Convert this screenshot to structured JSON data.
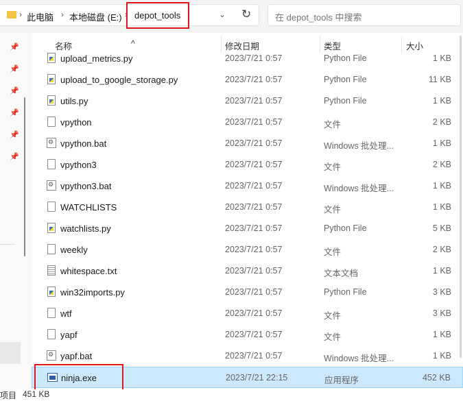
{
  "addressbar": {
    "crumbs": [
      "此电脑",
      "本地磁盘 (E:)",
      "depot_tools"
    ],
    "separator": "›",
    "dropdown_glyph": "⌄",
    "refresh_glyph": "↻"
  },
  "search": {
    "placeholder": "在 depot_tools 中搜索"
  },
  "columns": {
    "name": "名称",
    "date": "修改日期",
    "type": "类型",
    "size": "大小"
  },
  "files": [
    {
      "name": "upload_metrics.py",
      "date": "2023/7/21 0:57",
      "type": "Python File",
      "size": "1 KB",
      "icon": "python-file-icon"
    },
    {
      "name": "upload_to_google_storage.py",
      "date": "2023/7/21 0:57",
      "type": "Python File",
      "size": "11 KB",
      "icon": "python-file-icon"
    },
    {
      "name": "utils.py",
      "date": "2023/7/21 0:57",
      "type": "Python File",
      "size": "1 KB",
      "icon": "python-file-icon"
    },
    {
      "name": "vpython",
      "date": "2023/7/21 0:57",
      "type": "文件",
      "size": "2 KB",
      "icon": "file-icon"
    },
    {
      "name": "vpython.bat",
      "date": "2023/7/21 0:57",
      "type": "Windows 批处理...",
      "size": "1 KB",
      "icon": "batch-file-icon"
    },
    {
      "name": "vpython3",
      "date": "2023/7/21 0:57",
      "type": "文件",
      "size": "2 KB",
      "icon": "file-icon"
    },
    {
      "name": "vpython3.bat",
      "date": "2023/7/21 0:57",
      "type": "Windows 批处理...",
      "size": "1 KB",
      "icon": "batch-file-icon"
    },
    {
      "name": "WATCHLISTS",
      "date": "2023/7/21 0:57",
      "type": "文件",
      "size": "1 KB",
      "icon": "file-icon"
    },
    {
      "name": "watchlists.py",
      "date": "2023/7/21 0:57",
      "type": "Python File",
      "size": "5 KB",
      "icon": "python-file-icon"
    },
    {
      "name": "weekly",
      "date": "2023/7/21 0:57",
      "type": "文件",
      "size": "2 KB",
      "icon": "file-icon"
    },
    {
      "name": "whitespace.txt",
      "date": "2023/7/21 0:57",
      "type": "文本文档",
      "size": "1 KB",
      "icon": "text-file-icon"
    },
    {
      "name": "win32imports.py",
      "date": "2023/7/21 0:57",
      "type": "Python File",
      "size": "3 KB",
      "icon": "python-file-icon"
    },
    {
      "name": "wtf",
      "date": "2023/7/21 0:57",
      "type": "文件",
      "size": "3 KB",
      "icon": "file-icon"
    },
    {
      "name": "yapf",
      "date": "2023/7/21 0:57",
      "type": "文件",
      "size": "1 KB",
      "icon": "file-icon"
    },
    {
      "name": "yapf.bat",
      "date": "2023/7/21 0:57",
      "type": "Windows 批处理...",
      "size": "1 KB",
      "icon": "batch-file-icon"
    },
    {
      "name": "ninja.exe",
      "date": "2023/7/21 22:15",
      "type": "应用程序",
      "size": "452 KB",
      "icon": "exe-file-icon",
      "selected": true
    }
  ],
  "statusbar": {
    "items": "项目",
    "selection_size": "451 KB"
  },
  "colors": {
    "highlight_box": "#e0141c",
    "selection_bg": "#cce8ff"
  }
}
